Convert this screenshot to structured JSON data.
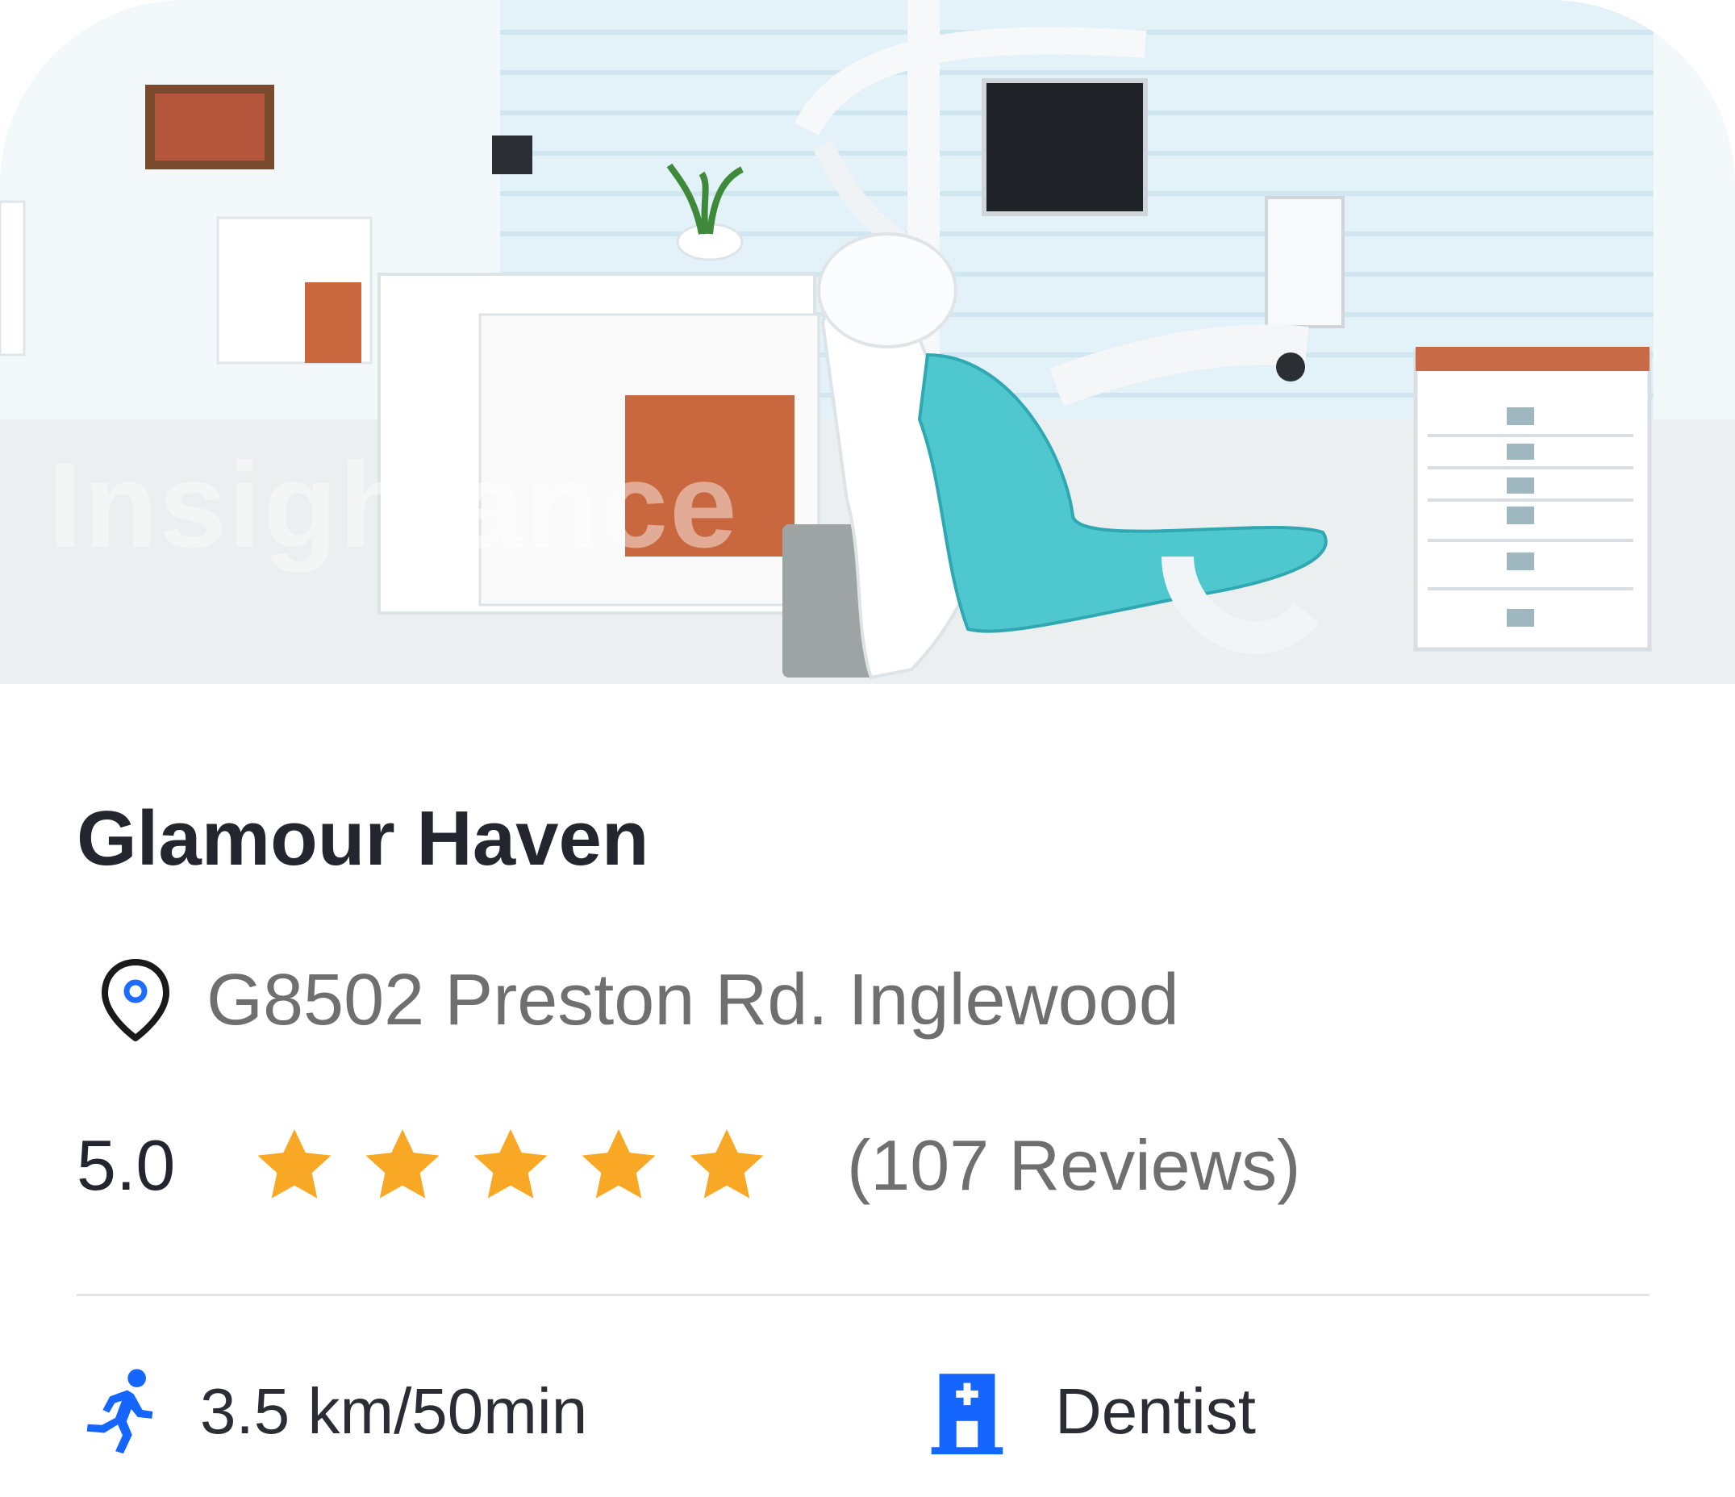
{
  "listing": {
    "photo_icon": "dental-clinic-photo",
    "watermark": "Insightance",
    "name": "Glamour Haven",
    "address": "G8502 Preston Rd. Inglewood",
    "address_icon": "location-pin-icon",
    "rating": "5.0",
    "stars": 5,
    "star_color": "#f9a825",
    "reviews": "(107 Reviews)",
    "distance": "3.5 km/50min",
    "distance_icon": "running-person-icon",
    "category": "Dentist",
    "category_icon": "hospital-icon",
    "accent_color": "#1565ff"
  }
}
